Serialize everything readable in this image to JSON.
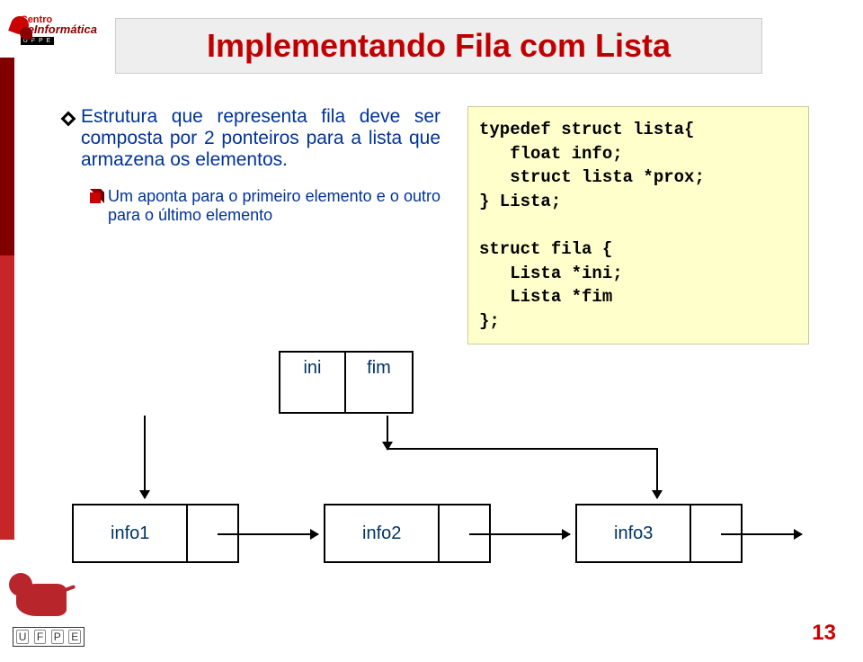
{
  "logo": {
    "line1": "Centro",
    "line2": "deInformática",
    "line3": "U F P E",
    "letters": [
      "U",
      "F",
      "P",
      "E"
    ]
  },
  "title": "Implementando Fila com Lista",
  "bullets": {
    "main": "Estrutura que representa fila deve ser composta por 2 ponteiros para a lista que armazena os elementos.",
    "sub": "Um aponta para o primeiro elemento e o outro para o último elemento"
  },
  "code": "typedef struct lista{\n   float info;\n   struct lista *prox;\n} Lista;\n\nstruct fila {\n   Lista *ini;\n   Lista *fim\n};",
  "inifim": {
    "ini": "ini",
    "fim": "fim"
  },
  "nodes": {
    "n1": "info1",
    "n2": "info2",
    "n3": "info3"
  },
  "pagenum": "13"
}
